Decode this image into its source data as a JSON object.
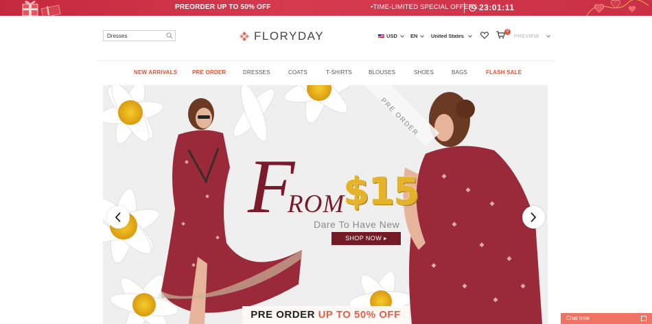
{
  "promo": {
    "left_text": "PREORDER UP TO 50% OFF",
    "right_text": "•TIME-LIMITED SPECIAL OFFERS.",
    "timer": "23:01:11",
    "icons": [
      "gift-icon",
      "clock-icon",
      "heart-balloons-icon"
    ],
    "colors": {
      "bar": "#c4283e"
    }
  },
  "header": {
    "search": {
      "value": "Dresses",
      "placeholder": ""
    },
    "logo_text": "FLORYDAY",
    "currency": "USD",
    "language": "EN",
    "country": "United States",
    "cart_count": "0",
    "preview_label": "PREVIEW"
  },
  "nav": {
    "items": [
      {
        "label": "NEW ARRIVALS",
        "hot": true
      },
      {
        "label": "PRE ORDER",
        "hot": true
      },
      {
        "label": "DRESSES",
        "hot": false
      },
      {
        "label": "COATS",
        "hot": false
      },
      {
        "label": "T-SHIRTS",
        "hot": false
      },
      {
        "label": "BLOUSES",
        "hot": false
      },
      {
        "label": "SHOES",
        "hot": false
      },
      {
        "label": "BAGS",
        "hot": false
      },
      {
        "label": "FLASH SALE",
        "hot": true
      }
    ],
    "colors": {
      "hot": "#e0532e",
      "normal": "#555555"
    }
  },
  "banner": {
    "ribbon": "PRE ORDER",
    "from_letter": "F",
    "from_rest": "ROM",
    "price": "$15",
    "tagline": "Dare To Have New",
    "cta": "SHOP NOW ▸",
    "strip_dark": "PRE ORDER",
    "strip_hot": "UP TO 50% OFF",
    "colors": {
      "accent": "#741a27",
      "gold": "#e5b32a",
      "dress": "#9a2a3a"
    }
  },
  "chat": {
    "label": "Chat now"
  }
}
